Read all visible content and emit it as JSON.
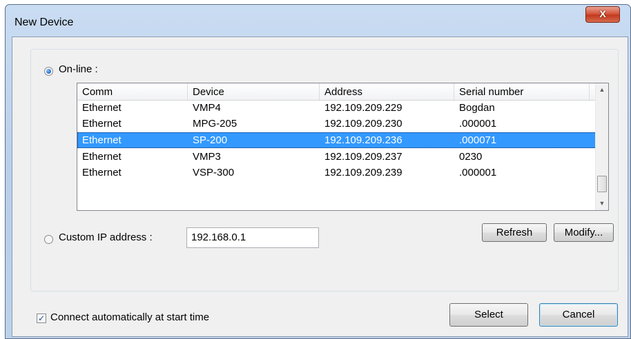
{
  "window": {
    "title": "New Device",
    "close_label": "X"
  },
  "online": {
    "label": "On-line :",
    "checked": true
  },
  "table": {
    "columns": [
      "Comm",
      "Device",
      "Address",
      "Serial number"
    ],
    "rows": [
      [
        "Ethernet",
        "VMP4",
        "192.109.209.229",
        "Bogdan"
      ],
      [
        "Ethernet",
        "MPG-205",
        "192.109.209.230",
        ".000001"
      ],
      [
        "Ethernet",
        "SP-200",
        "192.109.209.236",
        ".000071"
      ],
      [
        "Ethernet",
        "VMP3",
        "192.109.209.237",
        "0230"
      ],
      [
        "Ethernet",
        "VSP-300",
        "192.109.209.239",
        ".000001"
      ]
    ],
    "selected_row": 2,
    "scroll_up_icon": "arrow-up",
    "scroll_down_icon": "arrow-down"
  },
  "custom_ip": {
    "label": "Custom IP address :",
    "value": "192.168.0.1",
    "checked": false
  },
  "buttons": {
    "refresh": "Refresh",
    "modify": "Modify...",
    "select": "Select",
    "cancel": "Cancel"
  },
  "autoconnect": {
    "label": "Connect automatically at start time",
    "checked": true
  }
}
